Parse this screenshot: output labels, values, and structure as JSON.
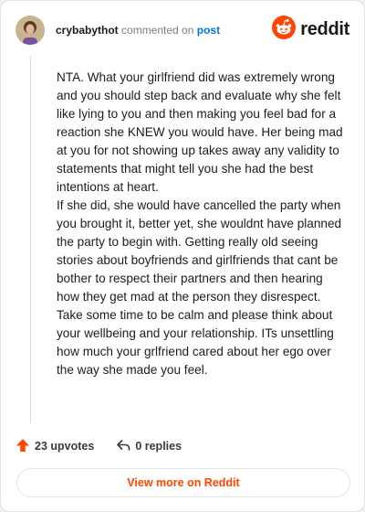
{
  "header": {
    "username": "crybabythot",
    "commented_text": "commented on",
    "post_link": "post",
    "logo_word": "reddit"
  },
  "comment": {
    "paragraphs": [
      "NTA. What your girlfriend did was extremely wrong and you should step back and evaluate why she felt like lying to you and then making you feel bad for a reaction she KNEW you would have. Her being mad at you for not showing up takes away any validity to statements that might tell you she had the best intentions at heart.",
      "If she did, she would have cancelled the party when you brought it, better yet, she wouldnt have planned the party to begin with. Getting really old seeing stories about boyfriends and girlfriends that cant be bother to respect their partners and then hearing how they get mad at the person they disrespect.",
      "Take some time to be calm and please think about your wellbeing and your relationship. ITs unsettling how much your grlfriend cared about her ego over the way she made you feel."
    ]
  },
  "actions": {
    "upvotes": "23 upvotes",
    "replies": "0 replies"
  },
  "footer": {
    "view_more": "View more on Reddit"
  },
  "colors": {
    "accent": "#ff4500",
    "link": "#0079d3"
  },
  "icons": {
    "upvote": "upvote-arrow-icon",
    "reply": "reply-arrow-icon",
    "logo": "reddit-snoo-icon"
  }
}
